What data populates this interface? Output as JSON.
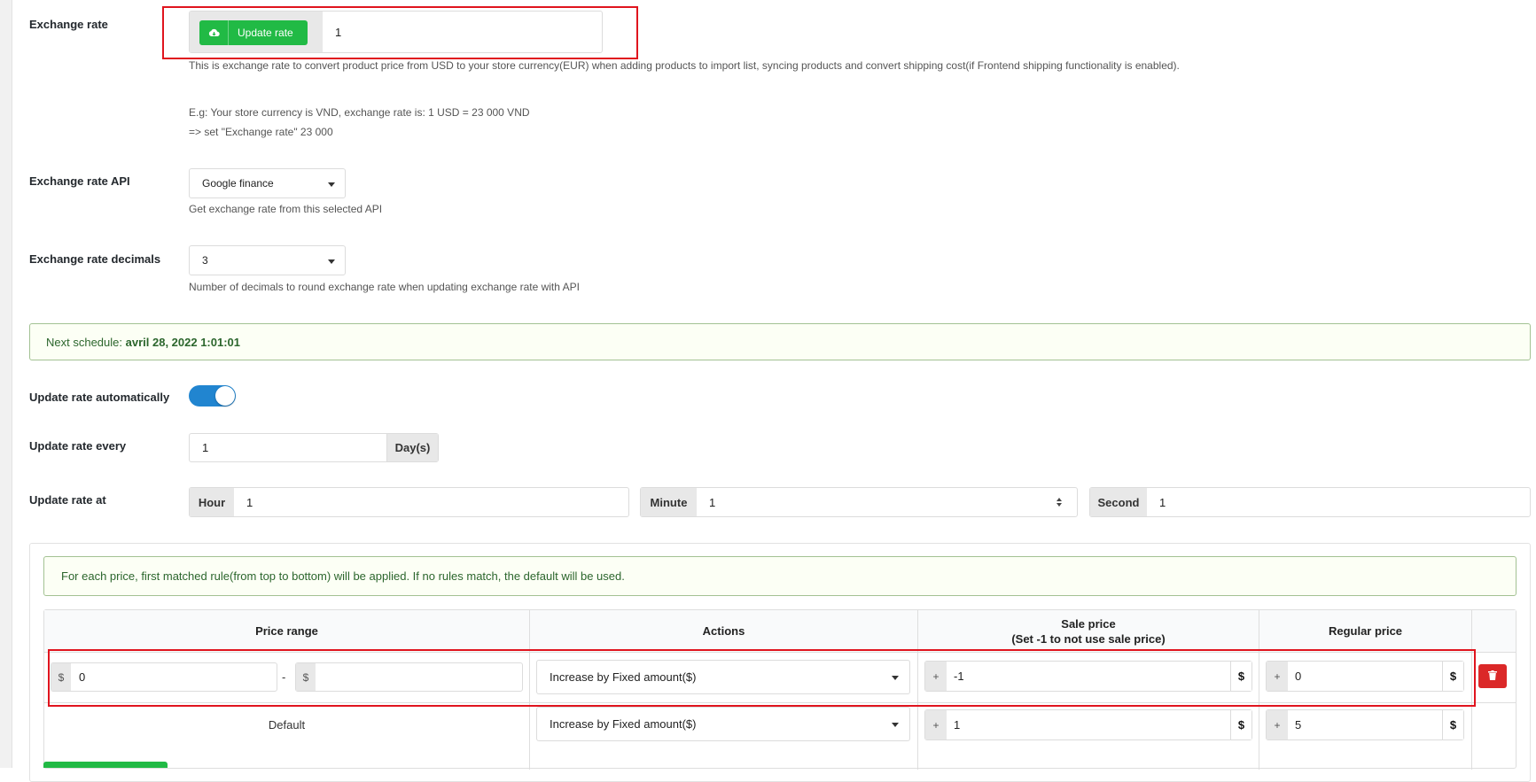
{
  "colors": {
    "accent": "#2185d0",
    "success": "#21ba45",
    "danger": "#db2828",
    "highlight": "#e0141e"
  },
  "exchange_rate": {
    "label": "Exchange rate",
    "button_label": "Update rate",
    "value": "1",
    "desc1": "This is exchange rate to convert product price from USD to your store currency(EUR) when adding products to import list, syncing products and convert shipping cost(if Frontend shipping functionality is enabled).",
    "desc2": "E.g: Your store currency is VND, exchange rate is: 1 USD = 23 000 VND",
    "desc3": "=> set \"Exchange rate\" 23 000"
  },
  "exchange_rate_api": {
    "label": "Exchange rate API",
    "selected": "Google finance",
    "desc": "Get exchange rate from this selected API"
  },
  "exchange_rate_decimals": {
    "label": "Exchange rate decimals",
    "selected": "3",
    "desc": "Number of decimals to round exchange rate when updating exchange rate with API"
  },
  "next_schedule": {
    "prefix": "Next schedule:",
    "value": "avril 28, 2022 1:01:01"
  },
  "update_auto": {
    "label": "Update rate automatically",
    "enabled": true
  },
  "update_every": {
    "label": "Update rate every",
    "value": "1",
    "unit": "Day(s)"
  },
  "update_at": {
    "label": "Update rate at",
    "hour_label": "Hour",
    "hour_value": "1",
    "minute_label": "Minute",
    "minute_value": "1",
    "second_label": "Second",
    "second_value": "1"
  },
  "rules_notice": "For each price, first matched rule(from top to bottom) will be applied. If no rules match, the default will be used.",
  "table": {
    "headers": {
      "price_range": "Price range",
      "actions": "Actions",
      "sale_line1": "Sale price",
      "sale_line2": "(Set -1 to not use sale price)",
      "regular": "Regular price"
    },
    "row": {
      "currency": "$",
      "from": "0",
      "separator": "-",
      "to": "",
      "action": "Increase by Fixed amount($)",
      "plus": "+",
      "sale": "-1",
      "regular": "0"
    },
    "default_row": {
      "label": "Default",
      "action": "Increase by Fixed amount($)",
      "plus": "+",
      "currency": "$",
      "sale": "1",
      "regular": "5"
    }
  }
}
